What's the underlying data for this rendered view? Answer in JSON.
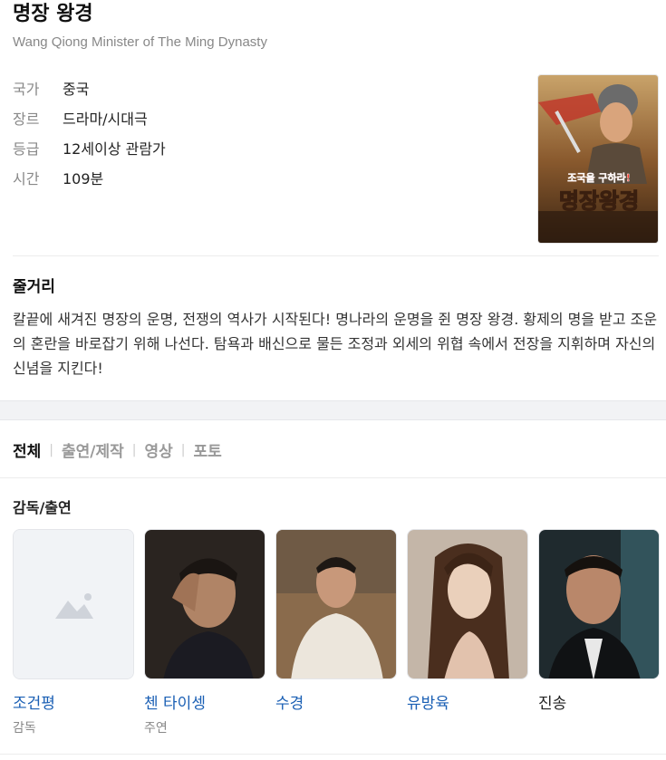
{
  "movie": {
    "title": "명장 왕경",
    "subtitle": "Wang Qiong Minister of The Ming Dynasty"
  },
  "info": [
    {
      "key": "국가",
      "value": "중국"
    },
    {
      "key": "장르",
      "value": "드라마/시대극"
    },
    {
      "key": "등급",
      "value": "12세이상 관람가"
    },
    {
      "key": "시간",
      "value": "109분"
    }
  ],
  "poster": {
    "tagline": "조국을 구하라!",
    "title_text": "명장왕경"
  },
  "plot": {
    "heading": "줄거리",
    "text": "칼끝에 새겨진 명장의 운명, 전쟁의 역사가 시작된다! 명나라의 운명을 쥔 명장 왕경. 황제의 명을 받고 조운의 혼란을 바로잡기 위해 나선다. 탐욕과 배신으로 물든 조정과 외세의 위협 속에서 전장을 지휘하며 자신의 신념을 지킨다!"
  },
  "tabs": [
    "전체",
    "출연/제작",
    "영상",
    "포토"
  ],
  "cast_section": {
    "title": "감독/출연",
    "people": [
      {
        "name": "조건평",
        "role": "감독",
        "photo": "placeholder-image-icon"
      },
      {
        "name": "첸 타이셍",
        "role": "주연",
        "photo": "actor-photo"
      },
      {
        "name": "수경",
        "role": "",
        "photo": "actor-photo"
      },
      {
        "name": "유방육",
        "role": "",
        "photo": "actress-photo"
      },
      {
        "name": "진송",
        "role": "",
        "photo": "actor-photo"
      }
    ]
  },
  "colors": {
    "link": "#1a5fb4",
    "muted": "#888888",
    "band": "#f2f3f5"
  }
}
